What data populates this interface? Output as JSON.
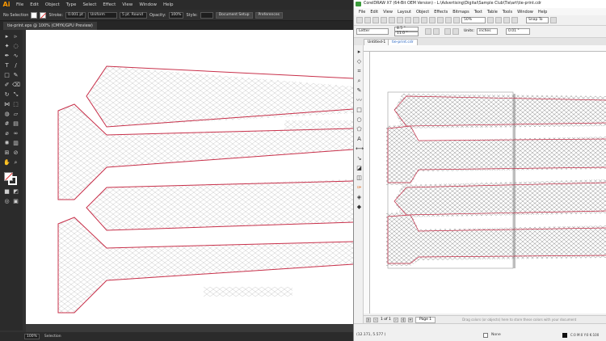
{
  "ai": {
    "logo": "Ai",
    "menu": [
      "File",
      "Edit",
      "Object",
      "Type",
      "Select",
      "Effect",
      "View",
      "Window",
      "Help"
    ],
    "control": {
      "selection": "No Selection",
      "stroke_label": "Stroke:",
      "stroke_value": "0.001 pt",
      "profile": "Uniform",
      "brush": "5 pt. Round",
      "opacity_label": "Opacity:",
      "opacity_value": "100%",
      "style_label": "Style:",
      "doc_setup": "Document Setup",
      "preferences": "Preferences"
    },
    "tab": "tie-print.eps @ 100% (CMYK/GPU Preview)",
    "status": {
      "zoom": "100%",
      "mode": "Selection"
    }
  },
  "cd": {
    "title": "CorelDRAW X7 (64-Bit OEM Version) - L:\\Advertising\\Digital\\Sample Club\\Tie\\art\\tie-print.cdr",
    "menu": [
      "File",
      "Edit",
      "View",
      "Layout",
      "Object",
      "Effects",
      "Bitmaps",
      "Text",
      "Table",
      "Tools",
      "Window",
      "Help"
    ],
    "toolbar": {
      "zoom": "50%",
      "snap": "Snap To"
    },
    "prop": {
      "page": "Letter",
      "w": "8.5 \"",
      "h": "11.0 \"",
      "units_label": "Units:",
      "units": "inches",
      "nudge": "0.01 \""
    },
    "tabs": [
      "Untitled-1",
      "tie-print.cdr"
    ],
    "pagenav": {
      "of": "1 of 1",
      "page": "Page 1",
      "hint": "Drag colors (or objects) here to store these colors with your document"
    },
    "status": {
      "coords": "(12.171, 5.577 )",
      "fill": "None",
      "color": "C:0 M:0 Y:0 K:100"
    }
  },
  "colors": {
    "path_red": "#c8304a",
    "pattern_gray": "#c0c0c0",
    "cd_pattern": "#909090"
  }
}
